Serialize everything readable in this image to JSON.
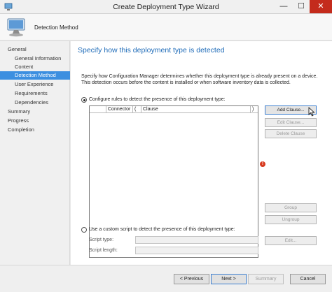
{
  "window": {
    "title": "Create Deployment Type Wizard",
    "minimize_glyph": "—",
    "maximize_glyph": "☐",
    "close_glyph": "✕",
    "icon": "wizard-computer-icon"
  },
  "header": {
    "page_name": "Detection Method",
    "icon": "computer-monitor-icon"
  },
  "nav": {
    "items": [
      {
        "label": "General",
        "level": 0,
        "selected": false
      },
      {
        "label": "General Information",
        "level": 1,
        "selected": false
      },
      {
        "label": "Content",
        "level": 1,
        "selected": false
      },
      {
        "label": "Detection Method",
        "level": 1,
        "selected": true
      },
      {
        "label": "User Experience",
        "level": 1,
        "selected": false
      },
      {
        "label": "Requirements",
        "level": 1,
        "selected": false
      },
      {
        "label": "Dependencies",
        "level": 1,
        "selected": false
      },
      {
        "label": "Summary",
        "level": 0,
        "selected": false
      },
      {
        "label": "Progress",
        "level": 0,
        "selected": false
      },
      {
        "label": "Completion",
        "level": 0,
        "selected": false
      }
    ]
  },
  "main": {
    "heading": "Specify how this deployment type is detected",
    "description": "Specify how Configuration Manager determines whether this deployment type is already present on a device. This detection occurs before the content is installed or when software inventory data is collected.",
    "option_rules": {
      "label": "Configure rules to detect the presence of this deployment type:",
      "selected": true
    },
    "clause_table": {
      "columns": [
        "",
        "Connector",
        "(",
        "Clause",
        ")"
      ]
    },
    "buttons": {
      "add_clause": "Add Clause...",
      "edit_clause": "Edit Clause...",
      "delete_clause": "Delete Clause",
      "group": "Group",
      "ungroup": "Ungroup",
      "edit": "Edit..."
    },
    "option_script": {
      "label": "Use a custom script to detect the presence of this deployment type:",
      "selected": false
    },
    "script_type_label": "Script type:",
    "script_type_value": "",
    "script_length_label": "Script length:",
    "script_length_value": "",
    "warning_glyph": "!",
    "colors": {
      "accent": "#3c8fe0",
      "heading": "#1e6bb8",
      "warning": "#d7381d",
      "close": "#c42b1c"
    }
  },
  "footer": {
    "previous": "< Previous",
    "next": "Next >",
    "summary": "Summary",
    "cancel": "Cancel"
  }
}
